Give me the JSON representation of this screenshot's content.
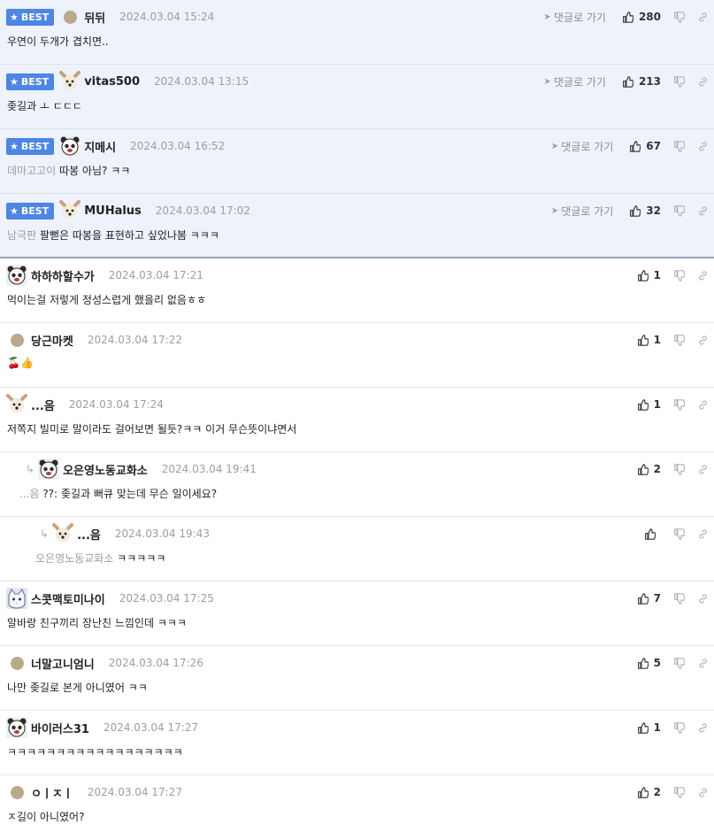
{
  "best_label": "BEST",
  "reply_link_label": "댓글로 가기",
  "comments": [
    {
      "best": true,
      "avatar": "dot",
      "nick": "뒤뒤",
      "date": "2024.03.04 15:24",
      "likes": "280",
      "mention": "",
      "text": "우연이 두개가 겹치면.."
    },
    {
      "best": true,
      "avatar": "dog",
      "nick": "vitas500",
      "date": "2024.03.04 13:15",
      "likes": "213",
      "mention": "",
      "text": "좆길과 ㅗ ㄷㄷㄷ"
    },
    {
      "best": true,
      "avatar": "bear",
      "nick": "지메시",
      "date": "2024.03.04 16:52",
      "likes": "67",
      "mention": "데마고고이",
      "text": "따봉 아님? ㅋㅋ"
    },
    {
      "best": true,
      "avatar": "dog",
      "nick": "MUHalus",
      "date": "2024.03.04 17:02",
      "likes": "32",
      "mention": "남극판",
      "text": "팔뻗은 따봉을 표현하고 싶었나봄 ㅋㅋㅋ"
    },
    {
      "best": false,
      "avatar": "bear",
      "nick": "하하하할수가",
      "date": "2024.03.04 17:21",
      "likes": "1",
      "mention": "",
      "text": "먹이는걸 저렇게 정성스럽게 했을리 없음ㅎㅎ"
    },
    {
      "best": false,
      "avatar": "dot",
      "nick": "당근마켓",
      "date": "2024.03.04 17:22",
      "likes": "1",
      "mention": "",
      "text": "🍒👍"
    },
    {
      "best": false,
      "avatar": "dog",
      "nick": "...음",
      "date": "2024.03.04 17:24",
      "likes": "1",
      "mention": "",
      "text": "저쪽지 빌미로 말이라도 걸어보면 될듯?ㅋㅋ 이거 무슨뜻이냐면서"
    },
    {
      "best": false,
      "reply": 1,
      "avatar": "bear",
      "nick": "오은영노동교화소",
      "date": "2024.03.04 19:41",
      "likes": "2",
      "mention": "...음",
      "text": "??: 좆길과 뻐큐 맞는데 무슨 일이세요?"
    },
    {
      "best": false,
      "reply": 2,
      "avatar": "dog",
      "nick": "...음",
      "date": "2024.03.04 19:43",
      "likes": "",
      "mention": "오은영노동교화소",
      "text": "ㅋㅋㅋㅋㅋ"
    },
    {
      "best": false,
      "avatar": "cat",
      "nick": "스콧맥토미나이",
      "date": "2024.03.04 17:25",
      "likes": "7",
      "mention": "",
      "text": "알바랑 친구끼리 장난친 느낌인데 ㅋㅋㅋ"
    },
    {
      "best": false,
      "avatar": "dot",
      "nick": "너말고니엄니",
      "date": "2024.03.04 17:26",
      "likes": "5",
      "mention": "",
      "text": "나만 좆길로 본게 아니였어 ㅋㅋ"
    },
    {
      "best": false,
      "avatar": "bear",
      "nick": "바이러스31",
      "date": "2024.03.04 17:27",
      "likes": "1",
      "mention": "",
      "text": "ㅋㅋㅋㅋㅋㅋㅋㅋㅋㅋㅋㅋㅋㅋㅋㅋㅋㅋ"
    },
    {
      "best": false,
      "avatar": "dot",
      "nick": "ㅇㅣㅈㅣ",
      "date": "2024.03.04 17:27",
      "likes": "2",
      "mention": "",
      "text": "ㅈ길이 아니였어?"
    }
  ],
  "colors": {
    "best_badge": "#4d86e4",
    "best_bg": "#eef2fb",
    "date": "#9a9ea6"
  }
}
